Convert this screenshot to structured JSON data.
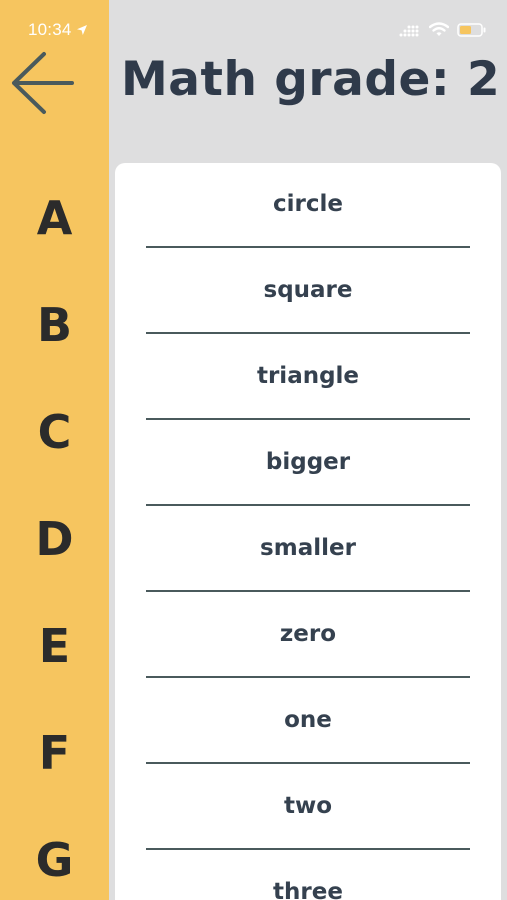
{
  "status_bar": {
    "time": "10:34"
  },
  "header": {
    "title": "Math grade: 2"
  },
  "alphabet": [
    "A",
    "B",
    "C",
    "D",
    "E",
    "F",
    "G"
  ],
  "words": [
    "circle",
    "square",
    "triangle",
    "bigger",
    "smaller",
    "zero",
    "one",
    "two",
    "three"
  ],
  "colors": {
    "rail": "#f6c55f",
    "background": "#dededf",
    "card": "#ffffff",
    "text": "#35414f",
    "battery": "#f6c55f"
  }
}
